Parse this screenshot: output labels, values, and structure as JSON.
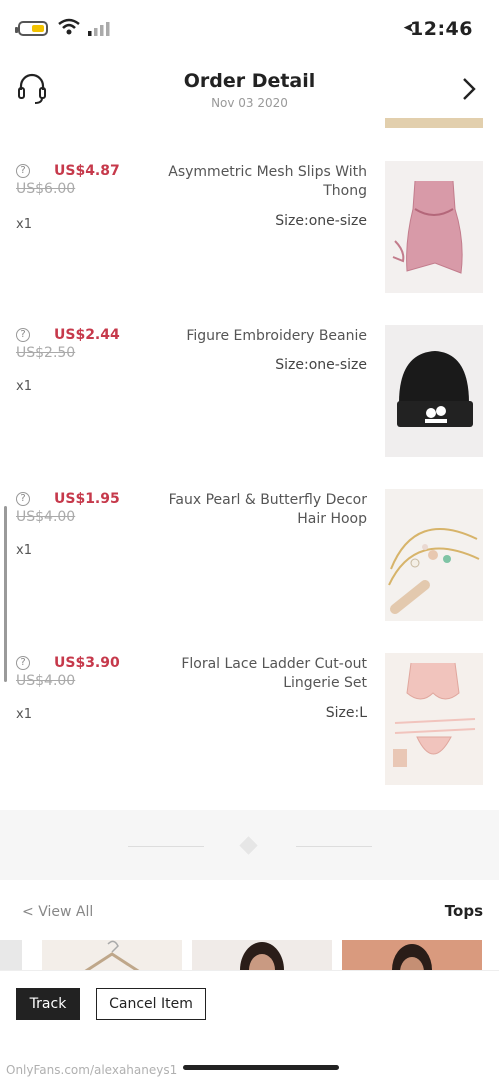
{
  "status_bar": {
    "time": "12:46",
    "location_icon": "location-arrow-icon"
  },
  "header": {
    "title": "Order Detail",
    "subtitle": "Nov 03 2020"
  },
  "items": [
    {
      "name": "Asymmetric Mesh Slips With Thong",
      "size": "Size:one-size",
      "sale_price": "US$4.87",
      "original_price": "US$6.00",
      "qty": "x1"
    },
    {
      "name": "Figure Embroidery Beanie",
      "size": "Size:one-size",
      "sale_price": "US$2.44",
      "original_price": "US$2.50",
      "qty": "x1"
    },
    {
      "name": "Faux Pearl & Butterfly Decor Hair Hoop",
      "size": "",
      "sale_price": "US$1.95",
      "original_price": "US$4.00",
      "qty": "x1"
    },
    {
      "name": "Floral Lace Ladder Cut-out Lingerie Set",
      "size": "Size:L",
      "sale_price": "US$3.90",
      "original_price": "US$4.00",
      "qty": "x1"
    }
  ],
  "recommend": {
    "section_title": "Tops",
    "view_all": "View All"
  },
  "actions": {
    "track_label": "Track",
    "cancel_label": "Cancel Item"
  },
  "watermark": "OnlyFans.com/alexahaneys1",
  "colors": {
    "sale_price": "#c6394b",
    "button_dark": "#222222"
  }
}
